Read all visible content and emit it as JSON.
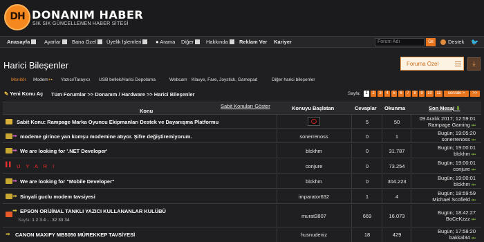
{
  "header": {
    "logo_mark": "DH",
    "logo_text": "DONANIM HABER",
    "logo_tagline": "SIK SIK GÜNCELLENEN HABER SİTESİ"
  },
  "nav": {
    "items": [
      {
        "label": "Anasayfa",
        "bold": true
      },
      {
        "label": "Ayarlar"
      },
      {
        "label": "Bana Özel"
      },
      {
        "label": "Üyelik İşlemleri"
      },
      {
        "label": "Arama"
      },
      {
        "label": "Diğer"
      },
      {
        "label": "Hakkında"
      },
      {
        "label": "Reklam Ver",
        "bold": true
      },
      {
        "label": "Kariyer",
        "bold": true
      }
    ],
    "search_placeholder": "Forum Adı",
    "go_label": "Git",
    "user_name": "Destek"
  },
  "page": {
    "title": "Harici Bileşenler",
    "forum_ozel_label": "Foruma Özel"
  },
  "subtabs": [
    "Monitör",
    "Modem",
    "Yazıcı/Tarayıcı",
    "USB bellek/Harici Depolama",
    "Webcam",
    "Klavye, Fare, Joystick, Gamepad",
    "Diğer harici bileşenler"
  ],
  "toolbar": {
    "new_topic_label": "Yeni Konu Aç",
    "breadcrumb": "Tüm Forumlar >> Donanım / Hardware >> Harici Bileşenler",
    "pager_label": "Sayfa:",
    "pages": [
      "1",
      "2",
      "3",
      "4",
      "5",
      "6",
      "7",
      "8",
      "9",
      "10",
      "11",
      "sonraki >",
      ">>"
    ]
  },
  "table": {
    "show_pinned_label": "Sabit Konuları Göster",
    "col_topic": "Konu",
    "col_starter": "Konuyu Başlatan",
    "col_replies": "Cevaplar",
    "col_views": "Okunma",
    "col_last": "Son Mesaj",
    "rows": [
      {
        "title": "Sabit Konu: Rampage Marka Oyuncu Ekipmanları Destek ve Dayanışma Platformu",
        "starter": "",
        "replies": "5",
        "views": "50",
        "last_date": "09 Aralık 2017; 12:59:01",
        "last_user": "Rampage Gaming"
      },
      {
        "title": "modeme girince yan komşu modemine atıyor. Şifre değiştiremiyorum.",
        "starter": "sonerrenoss",
        "replies": "0",
        "views": "1",
        "last_date": "Bugün; 19:05:20",
        "last_user": "sonerrenoss"
      },
      {
        "title": "We are looking for '.NET Developer'",
        "starter": "blckhm",
        "replies": "0",
        "views": "31.787",
        "last_date": "Bugün; 19:00:01",
        "last_user": "blckhm"
      },
      {
        "title": "U Y A R I",
        "starter": "conjure",
        "replies": "0",
        "views": "73.254",
        "last_date": "Bugün; 19:00:01",
        "last_user": "conjure"
      },
      {
        "title": "We are looking for \"Mobile Developer\"",
        "starter": "blckhm",
        "replies": "0",
        "views": "304.223",
        "last_date": "Bugün; 19:00:01",
        "last_user": "blckhm"
      },
      {
        "title": "Sinyali guclu modem tavsiyesi",
        "starter": "imparator632",
        "replies": "1",
        "views": "4",
        "last_date": "Bugün; 18:59:59",
        "last_user": "Michael Scofield"
      },
      {
        "title": "EPSON ORİJİNAL TANKLI YAZICI KULLANANLAR KULÜBÜ",
        "starter": "murat3807",
        "replies": "669",
        "views": "16.073",
        "last_date": "Bugün; 18:42:27",
        "last_user": "BoCeKzzz",
        "pages_label": "Sayfa:",
        "pages": "1 2 3 4 ... 32 33 34"
      },
      {
        "title": "CANON MAXIFY MB5050 MÜREKKEP TAVSİYESİ",
        "starter": "husnudeniz",
        "replies": "18",
        "views": "429",
        "last_date": "Bugün; 17:58:20",
        "last_user": "bakkal34"
      }
    ]
  }
}
